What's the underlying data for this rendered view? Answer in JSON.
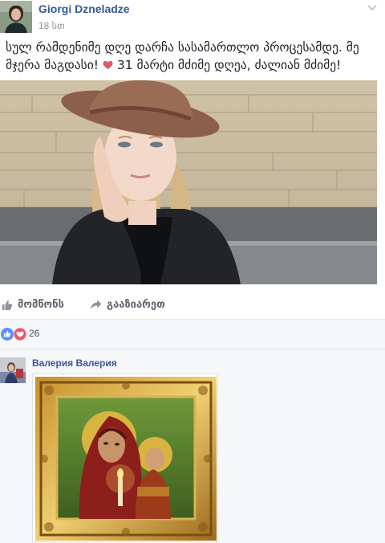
{
  "post": {
    "author": "Giorgi Dzneladze",
    "time": "18 სთ",
    "text": "სულ რამდენიმე დღე დარჩა სასამართლო პროცესამდე. მე მჯერა მაგდასი!",
    "text_after_heart": " 31 მარტი მძიმე დღეა, ძალიან მძიმე!",
    "icons": {
      "menu": "chevron-down-icon",
      "inline_emoji": "heart-icon"
    }
  },
  "actions": {
    "like_label": "მომწონს",
    "share_label": "გააზიარეთ"
  },
  "reactions": {
    "count": "26",
    "types": [
      "like",
      "love"
    ],
    "colors": {
      "like": "#5890ff",
      "love": "#f25268"
    }
  },
  "comment": {
    "author": "Валерия Валерия"
  },
  "colors": {
    "link": "#365899",
    "muted": "#90949c",
    "panel": "#f6f7f9"
  }
}
